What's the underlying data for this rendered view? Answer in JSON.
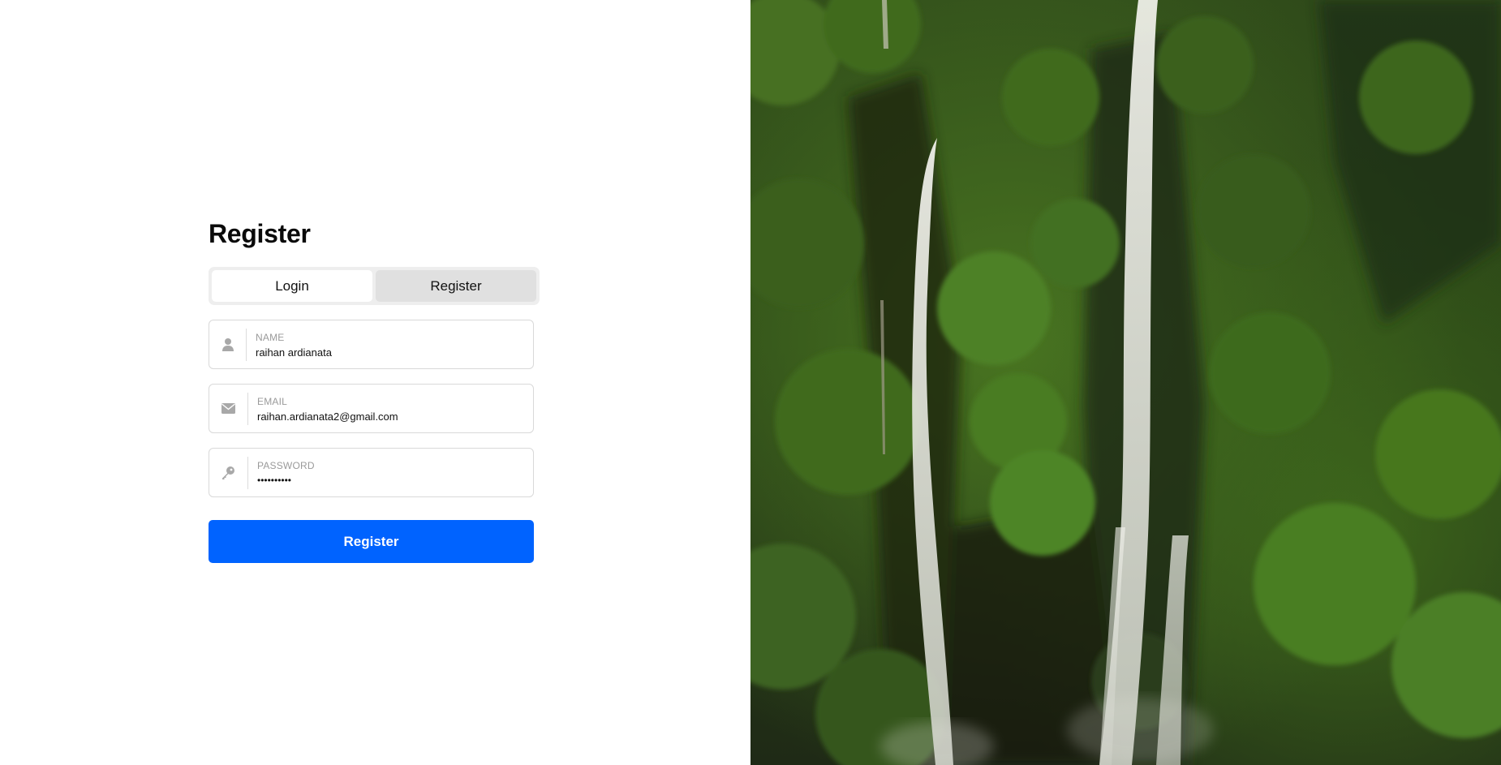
{
  "form": {
    "title": "Register",
    "tabs": [
      {
        "label": "Login",
        "active": false
      },
      {
        "label": "Register",
        "active": true
      }
    ],
    "name": {
      "label": "NAME",
      "value": "raihan ardianata",
      "icon": "user-icon"
    },
    "email": {
      "label": "EMAIL",
      "value": "raihan.ardianata2@gmail.com",
      "icon": "envelope-icon"
    },
    "password": {
      "label": "PASSWORD",
      "value": "••••••••••",
      "icon": "key-icon"
    },
    "submit_label": "Register"
  },
  "colors": {
    "accent": "#0063ff",
    "tab_active": "#e0e0e0",
    "tab_track": "#eeeeee",
    "field_border": "#d9d9d9"
  },
  "hero": {
    "icon": "waterfall-photo"
  }
}
